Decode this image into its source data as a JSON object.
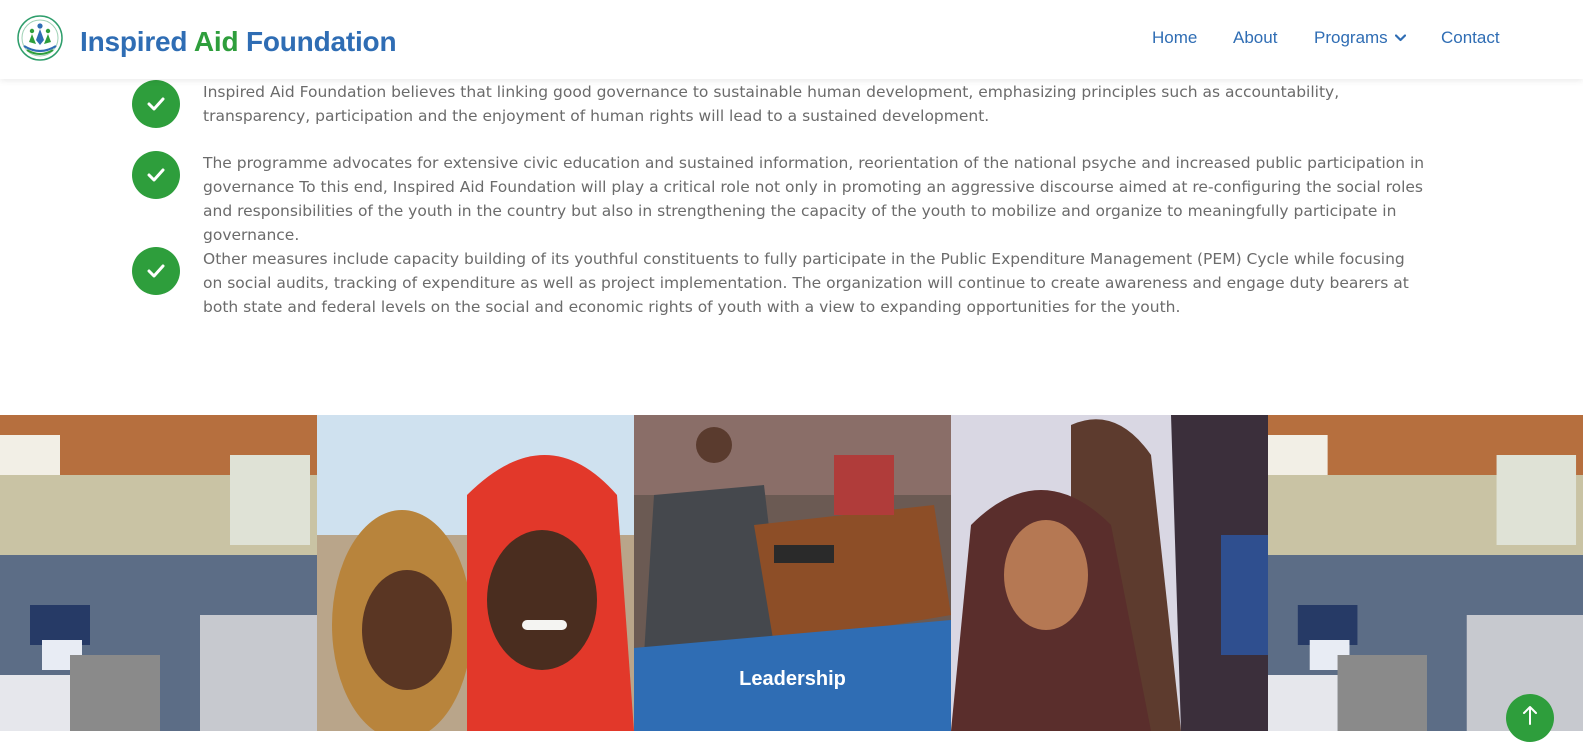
{
  "brand": {
    "name_part1": "Inspired",
    "name_part2": "Aid",
    "name_part3": "Foundation",
    "logo_icon": "lotus-people-icon"
  },
  "nav": {
    "home": "Home",
    "about": "About",
    "programs": "Programs",
    "contact": "Contact"
  },
  "items": [
    {
      "icon": "check-icon",
      "text": "Inspired Aid Foundation believes that linking good governance to sustainable human development, emphasizing principles such as accountability, transparency, participation and the enjoyment of human rights will lead to a sustained development."
    },
    {
      "icon": "check-icon",
      "text": "The programme advocates for extensive civic education and sustained information, reorientation of the national psyche and increased public participation in governance To this end, Inspired Aid Foundation will play a critical role not only in promoting an aggressive discourse aimed at re-configuring the social roles and responsibilities of the youth in the country but also in strengthening the capacity of the youth to mobilize and organize to meaningfully participate in governance."
    },
    {
      "icon": "check-icon",
      "text": "Other measures include capacity building of its youthful constituents to fully participate in the Public Expenditure Management (PEM) Cycle while focusing on social audits, tracking of expenditure as well as project implementation. The organization will continue to create awareness and engage duty bearers at both state and federal levels on the social and economic rights of youth with a view to expanding opportunities for the youth."
    }
  ],
  "gallery": {
    "leadership_label": "Leadership"
  },
  "colors": {
    "brand_blue": "#2f6db4",
    "brand_green": "#2e9e3c",
    "body_text": "#6b6b6b",
    "leader_band": "#2f6db4"
  },
  "scroll_top_icon": "arrow-up-icon"
}
